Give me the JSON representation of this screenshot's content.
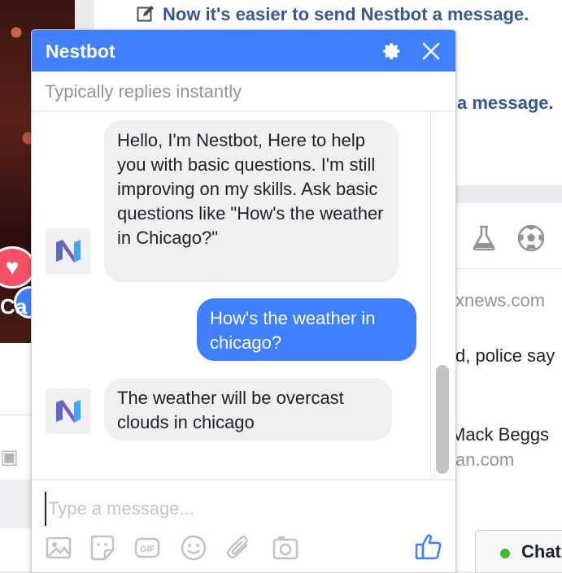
{
  "background": {
    "headline": "Now it's easier to send Nestbot a message.",
    "headline_partial": "a message.",
    "source_domain": "xnews.com",
    "snippet_police": "d, police say",
    "snippet_name": "Mack Beggs",
    "snippet_domain": "an.com",
    "chat_tab_label": "Chat",
    "overlay_text": "Ca"
  },
  "chat": {
    "title": "Nestbot",
    "subtitle": "Typically replies instantly",
    "accent_color": "#4080ff",
    "messages": [
      {
        "from": "bot",
        "text": "Hello, I'm Nestbot, Here to help you with basic questions. I'm still improving on my skills. Ask basic questions like \"How's the weather in Chicago?\""
      },
      {
        "from": "user",
        "text": "How's the weather in chicago?"
      },
      {
        "from": "bot",
        "text": "The weather will be overcast clouds in chicago"
      }
    ],
    "composer": {
      "placeholder": "Type a message...",
      "value": ""
    },
    "toolbar_icons": [
      "image-icon",
      "sticker-icon",
      "gif-icon",
      "emoji-icon",
      "attachment-icon",
      "camera-icon",
      "like-icon"
    ]
  }
}
